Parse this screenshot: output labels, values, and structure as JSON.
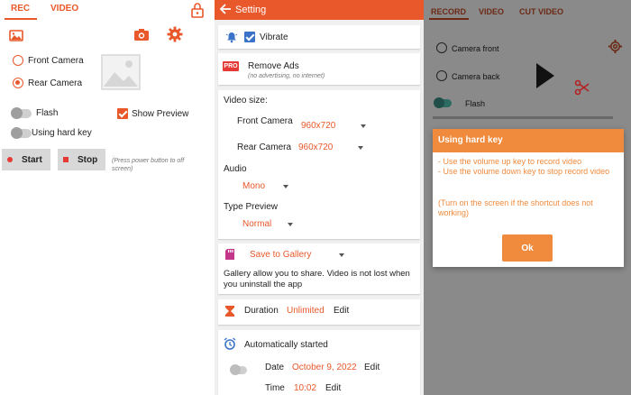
{
  "left_screen": {
    "tabs": [
      {
        "label": "REC"
      },
      {
        "label": "VIDEO"
      }
    ],
    "front_camera_label": "Front Camera",
    "rear_camera_label": "Rear Camera",
    "flash_label": "Flash",
    "show_preview_label": "Show Preview",
    "hard_key_label": "Using hard key",
    "start_label": "Start",
    "stop_label": "Stop",
    "hint": "(Press power button to off screen)",
    "selected_camera": "Rear Camera",
    "show_preview_checked": true
  },
  "settings_screen": {
    "title": "Setting",
    "vibrate_label": "Vibrate",
    "remove_ads_badge": "PRO",
    "remove_ads_label": "Remove Ads",
    "remove_ads_sub": "(no advertising, no internet)",
    "video_size_label": "Video size:",
    "front_camera_label": "Front Camera",
    "front_camera_value": "960x720",
    "rear_camera_label": "Rear Camera",
    "rear_camera_value": "960x720",
    "audio_label": "Audio",
    "audio_value": "Mono",
    "type_preview_label": "Type Preview",
    "type_preview_value": "Normal",
    "save_to_label": "Save to Gallery",
    "save_desc": "Gallery allow you to share. Video is not lost when you uninstall the app",
    "duration_label": "Duration",
    "duration_value": "Unlimited",
    "duration_edit": "Edit",
    "auto_start_label": "Automatically started",
    "date_label": "Date",
    "date_value": "October 9, 2022",
    "date_edit": "Edit",
    "time_label": "Time",
    "time_value": "10:02",
    "time_edit": "Edit"
  },
  "right_screen": {
    "tabs": [
      {
        "label": "RECORD"
      },
      {
        "label": "VIDEO"
      },
      {
        "label": "CUT VIDEO"
      }
    ],
    "camera_front_label": "Camera front",
    "camera_back_label": "Camera back",
    "flash_label": "Flash",
    "dialog": {
      "title": "Using hard key",
      "line1": "- Use the volume up key to record video",
      "line2": "- Use the volume down key to stop record video",
      "note": "(Turn on the screen if the shortcut does not working)",
      "ok_label": "Ok"
    }
  },
  "colors": {
    "accent": "#e8582a",
    "dialog_accent": "#f08a3c",
    "overlay": "#8a8a8a"
  }
}
